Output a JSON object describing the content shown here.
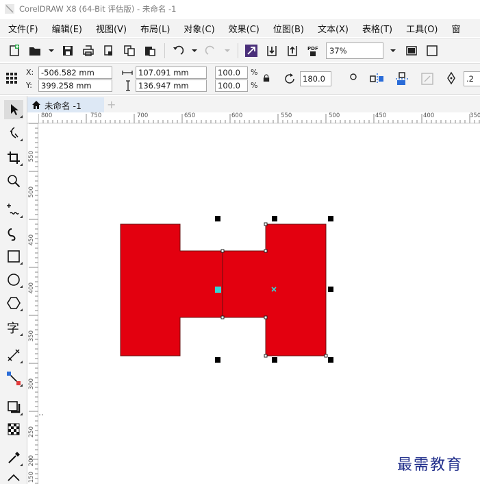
{
  "window": {
    "title": "CorelDRAW X8 (64-Bit 评估版) - 未命名 -1"
  },
  "menu": [
    "文件(F)",
    "编辑(E)",
    "视图(V)",
    "布局(L)",
    "对象(C)",
    "效果(C)",
    "位图(B)",
    "文本(X)",
    "表格(T)",
    "工具(O)",
    "窗"
  ],
  "toolbar": {
    "zoom_value": "37%"
  },
  "property_bar": {
    "x_label": "X:",
    "x_value": "-506.582 mm",
    "y_label": "Y:",
    "y_value": "399.258 mm",
    "width_value": "107.091 mm",
    "height_value": "136.947 mm",
    "scale_x": "100.0",
    "scale_y": "100.0",
    "percent": "%",
    "rotation": "180.0",
    "outline_width": ".2"
  },
  "document_tab": {
    "label": "未命名 -1"
  },
  "ruler": {
    "top_labels": [
      "800",
      "750",
      "700",
      "650",
      "600",
      "550",
      "500",
      "450",
      "400",
      "350"
    ],
    "left_labels": [
      "550",
      "500",
      "450",
      "400",
      "350",
      "300",
      "250",
      "200",
      "150"
    ]
  },
  "colors": {
    "shape_fill": "#e3000f",
    "handle_center": "#33d6d6",
    "watermark": "#1f2d8a"
  },
  "watermark": {
    "text": "最需教育"
  }
}
